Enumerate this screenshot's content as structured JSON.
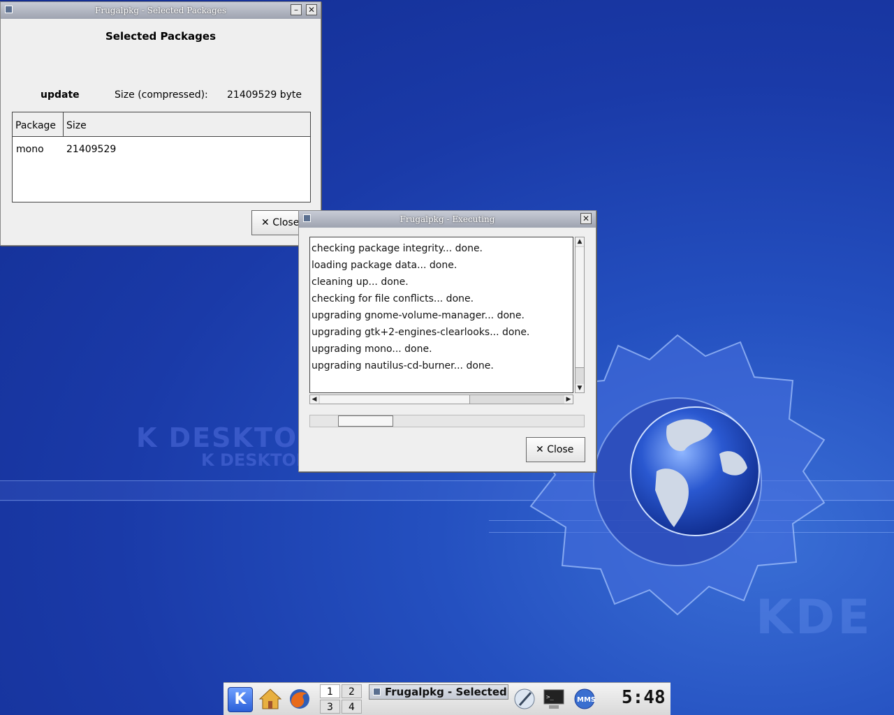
{
  "selected_window": {
    "title": "Frugalpkg - Selected Packages",
    "heading": "Selected Packages",
    "action": "update",
    "size_label": "Size (compressed):",
    "size_value": "21409529 byte",
    "table": {
      "columns": [
        "Package",
        "Size"
      ],
      "rows": [
        {
          "package": "mono",
          "size": "21409529"
        }
      ]
    },
    "close_label": "Close"
  },
  "exec_window": {
    "title": "Frugalpkg - Executing",
    "log": [
      "checking package integrity... done.",
      "loading package data... done.",
      "cleaning up... done.",
      "checking for file conflicts... done.",
      "upgrading gnome-volume-manager... done.",
      "upgrading gtk+2-engines-clearlooks... done.",
      "upgrading mono... done.",
      "upgrading nautilus-cd-burner... done."
    ],
    "close_label": "Close"
  },
  "wallpaper": {
    "text_large": "K DESKTOP",
    "text_small": "K DESKTOP",
    "brand": "KDE"
  },
  "taskbar": {
    "pager": [
      "1",
      "2",
      "3",
      "4"
    ],
    "task_label": "Frugalpkg - Selected",
    "clock": "5:48",
    "icons": [
      "kde-menu-icon",
      "home-icon",
      "firefox-icon",
      "editor-icon",
      "terminal-icon",
      "mms-icon"
    ]
  }
}
